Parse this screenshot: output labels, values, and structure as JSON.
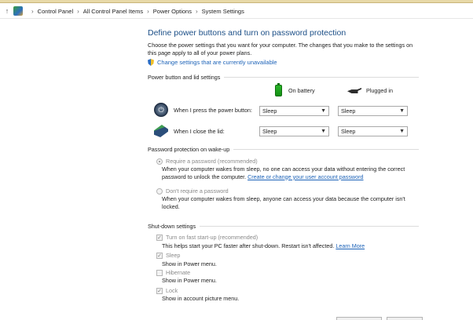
{
  "address_bar": {
    "up_icon": "up-arrow-icon",
    "app_icon": "control-panel-icon",
    "crumbs": [
      "Control Panel",
      "All Control Panel Items",
      "Power Options",
      "System Settings"
    ]
  },
  "page": {
    "title": "Define power buttons and turn on password protection",
    "intro": "Choose the power settings that you want for your computer. The changes that you make to the settings on this page apply to all of your power plans.",
    "unavailable_link": "Change settings that are currently unavailable"
  },
  "power_section": {
    "heading": "Power button and lid settings",
    "col_battery": "On battery",
    "col_plugged": "Plugged in",
    "rows": [
      {
        "label": "When I press the power button:",
        "battery": "Sleep",
        "plugged": "Sleep",
        "icon": "power-button-icon"
      },
      {
        "label": "When I close the lid:",
        "battery": "Sleep",
        "plugged": "Sleep",
        "icon": "laptop-lid-icon"
      }
    ]
  },
  "password_section": {
    "heading": "Password protection on wake-up",
    "require": {
      "label": "Require a password (recommended)",
      "selected": true,
      "desc_1": "When your computer wakes from sleep, no one can access your data without entering the correct password to unlock the computer. ",
      "desc_link": "Create or change your user account password"
    },
    "no_require": {
      "label": "Don't require a password",
      "selected": false,
      "desc": "When your computer wakes from sleep, anyone can access your data because the computer isn't locked."
    }
  },
  "shutdown_section": {
    "heading": "Shut-down settings",
    "items": [
      {
        "label": "Turn on fast start-up (recommended)",
        "checked": true,
        "desc": "This helps start your PC faster after shut-down. Restart isn't affected. ",
        "link": "Learn More"
      },
      {
        "label": "Sleep",
        "checked": true,
        "desc": "Show in Power menu."
      },
      {
        "label": "Hibernate",
        "checked": false,
        "desc": "Show in Power menu."
      },
      {
        "label": "Lock",
        "checked": true,
        "desc": "Show in account picture menu."
      }
    ]
  },
  "colors": {
    "title": "#1c4f87",
    "link": "#1d63b8",
    "battery": "#2ab52a"
  }
}
